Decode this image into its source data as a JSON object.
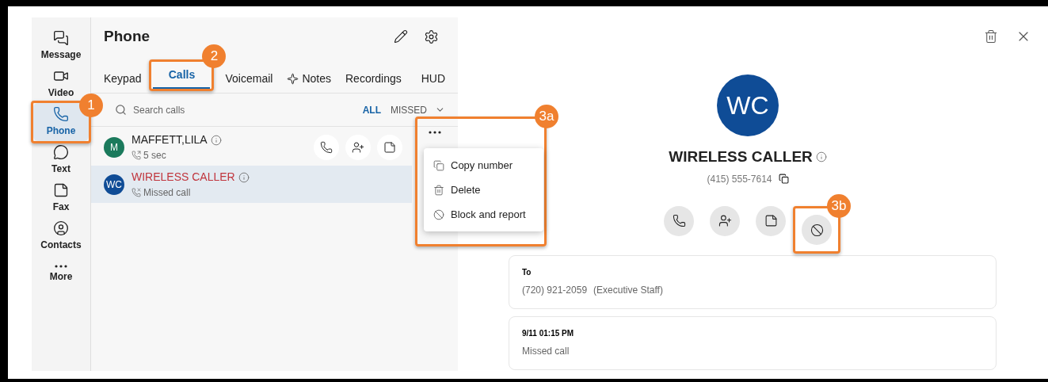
{
  "nav": [
    {
      "label": "Message",
      "selected": false
    },
    {
      "label": "Video",
      "selected": false
    },
    {
      "label": "Phone",
      "selected": true
    },
    {
      "label": "Text",
      "selected": false
    },
    {
      "label": "Fax",
      "selected": false
    },
    {
      "label": "Contacts",
      "selected": false
    },
    {
      "label": "More",
      "selected": false
    }
  ],
  "panel": {
    "title": "Phone",
    "tabs": [
      {
        "label": "Keypad",
        "selected": false,
        "kind": "plain"
      },
      {
        "label": "Calls",
        "selected": true,
        "kind": "plain"
      },
      {
        "label": "Voicemail",
        "selected": false,
        "kind": "plain"
      },
      {
        "label": "Notes",
        "selected": false,
        "kind": "sparkle"
      },
      {
        "label": "Recordings",
        "selected": false,
        "kind": "plain"
      },
      {
        "label": "HUD",
        "selected": false,
        "kind": "plain"
      }
    ],
    "search": {
      "placeholder": "Search calls"
    },
    "filters": [
      {
        "label": "ALL",
        "selected": true
      },
      {
        "label": "MISSED",
        "selected": false
      }
    ],
    "calls": [
      {
        "initials": "M",
        "name": "MAFFETT,LILA",
        "detail": "5 sec",
        "missed": false,
        "selected": false,
        "color": "#1b7a5c"
      },
      {
        "initials": "WC",
        "name": "WIRELESS CALLER",
        "detail": "Missed call",
        "missed": true,
        "selected": true,
        "color": "#0f4c96"
      }
    ]
  },
  "menu": {
    "items": [
      {
        "label": "Copy number",
        "kind": "copy"
      },
      {
        "label": "Delete",
        "kind": "delete"
      },
      {
        "label": "Block and report",
        "kind": "block"
      }
    ]
  },
  "detail": {
    "initials": "WC",
    "name": "WIRELESS CALLER",
    "phone": "(415) 555-7614",
    "cards": [
      {
        "title": "To",
        "value": "(720) 921-2059",
        "note": "(Executive Staff)"
      },
      {
        "title": "9/11 01:15 PM",
        "value": "Missed call"
      }
    ]
  },
  "callouts": [
    {
      "label": "1"
    },
    {
      "label": "2"
    },
    {
      "label": "3a"
    },
    {
      "label": "3b"
    }
  ]
}
